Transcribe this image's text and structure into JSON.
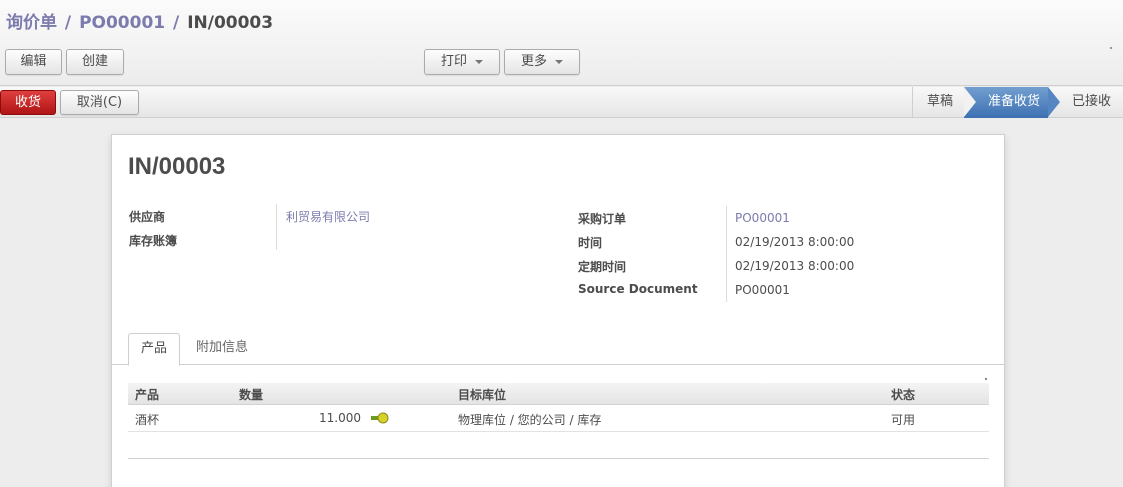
{
  "breadcrumb": {
    "items": [
      "询价单",
      "PO00001"
    ],
    "separator": "/",
    "current": "IN/00003"
  },
  "toolbar": {
    "edit_label": "编辑",
    "create_label": "创建",
    "print_label": "打印",
    "more_label": "更多"
  },
  "statusbar": {
    "receive_label": "收货",
    "cancel_label": "取消(C)",
    "steps": [
      "草稿",
      "准备收货",
      "已接收"
    ],
    "active_step": 1,
    "active_color": "#4a7ebd",
    "receive_color": "#c22222"
  },
  "record": {
    "title": "IN/00003",
    "left_fields": [
      {
        "label": "供应商",
        "value": "利贸易有限公司"
      },
      {
        "label": "库存账簿",
        "value": ""
      }
    ],
    "right_fields": [
      {
        "label": "采购订单",
        "value": "PO00001"
      },
      {
        "label": "时间",
        "value": "02/19/2013 8:00:00"
      },
      {
        "label": "定期时间",
        "value": "02/19/2013 8:00:00"
      },
      {
        "label": "Source Document",
        "value": "PO00001"
      }
    ]
  },
  "tabs": [
    "产品",
    "附加信息"
  ],
  "grid": {
    "headers": [
      "产品",
      "数量",
      "目标库位",
      "状态"
    ],
    "rows": [
      {
        "product": "酒杯",
        "quantity": "11.000",
        "icon": "move-arrow-icon",
        "location": "物理库位 / 您的公司 / 库存",
        "state": "可用"
      }
    ]
  }
}
